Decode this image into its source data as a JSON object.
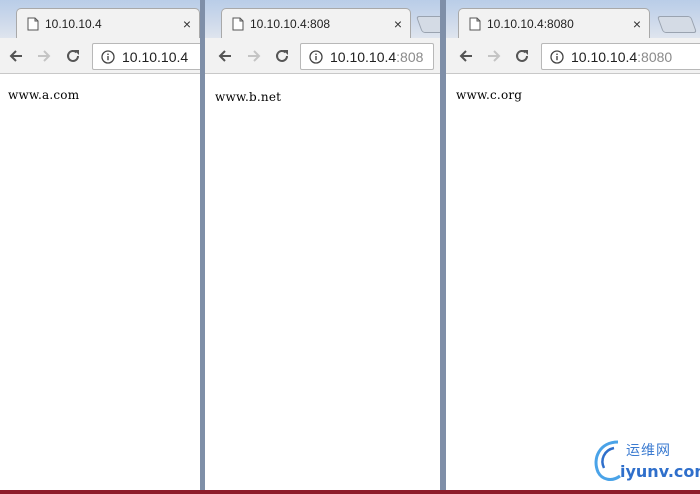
{
  "windows": [
    {
      "tab_title": "10.10.10.4",
      "url_host": "10.10.10.4",
      "url_port": "",
      "content_text": "www.a.com"
    },
    {
      "tab_title": "10.10.10.4:808",
      "url_host": "10.10.10.4",
      "url_port": ":808",
      "content_text": "www.b.net"
    },
    {
      "tab_title": "10.10.10.4:8080",
      "url_host": "10.10.10.4",
      "url_port": ":8080",
      "content_text": "www.c.org"
    }
  ],
  "icons": {
    "back": "arrow-left-icon",
    "forward": "arrow-right-icon",
    "reload": "reload-icon",
    "info": "info-circle-icon",
    "tab_close": "close-icon",
    "page": "page-icon"
  },
  "close_glyph": "×",
  "watermark": {
    "cn_text": "运维网",
    "site_text": "iyunv.com"
  },
  "colors": {
    "toolbar": "#f2f2f2",
    "titlebar": "#c9d6ea",
    "url_port": "#8a8a8a",
    "watermark": "#2f6fcb"
  }
}
